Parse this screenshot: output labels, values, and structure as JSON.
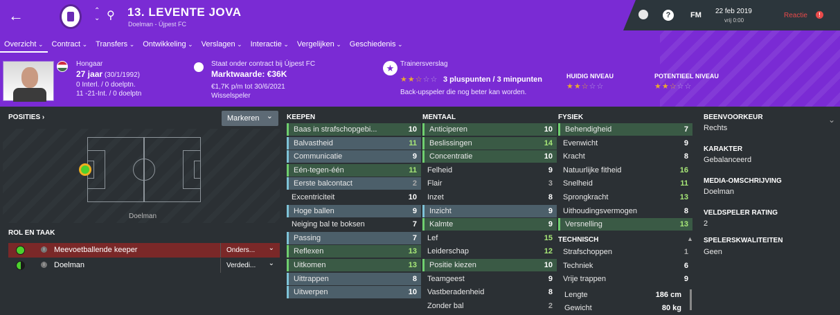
{
  "header": {
    "player_name": "13. LEVENTE JOVA",
    "subtitle": "Doelman - Újpest FC",
    "date": "22 feb 2019",
    "time": "vrij 0:00",
    "fm_label": "FM",
    "reactie": "Reactie"
  },
  "tabs": [
    "Overzicht",
    "Contract",
    "Transfers",
    "Ontwikkeling",
    "Verslagen",
    "Interactie",
    "Vergelijken",
    "Geschiedenis"
  ],
  "bio": {
    "nationality": "Hongaar",
    "age": "27 jaar",
    "dob": "(30/1/1992)",
    "caps": "0 Interl. / 0 doelptn.",
    "u21": "11 -21-Int. / 0 doelptn"
  },
  "contract": {
    "status": "Staat onder contract bij Újpest FC",
    "value": "Marktwaarde: €36K",
    "wage": "€1,7K p/m tot 30/6/2021",
    "role": "Wisselspeler"
  },
  "coach": {
    "title": "Trainersverslag",
    "points": "3 pluspunten / 3 minpunten",
    "desc": "Back-upspeler die nog beter kan worden.",
    "stars": "★★☆",
    "stars_off": "☆☆"
  },
  "levels": {
    "current_label": "HUIDIG NIVEAU",
    "potential_label": "POTENTIEEL NIVEAU",
    "current": "★★☆",
    "current_off": "☆☆",
    "potential": "★★☆",
    "potential_off": "☆☆"
  },
  "positions": {
    "title": "POSITIES ›",
    "marker": "Markeren",
    "position_label": "Doelman"
  },
  "roles": {
    "title": "ROL EN TAAK",
    "rows": [
      {
        "name": "Meevoetballende keeper",
        "duty": "Onders..."
      },
      {
        "name": "Doelman",
        "duty": "Verdedi..."
      }
    ]
  },
  "keepen": {
    "title": "KEEPEN",
    "items": [
      {
        "n": "Baas in strafschopgebi...",
        "v": "10"
      },
      {
        "n": "Balvastheid",
        "v": "11"
      },
      {
        "n": "Communicatie",
        "v": "9"
      },
      {
        "n": "Eén-tegen-één",
        "v": "11"
      },
      {
        "n": "Eerste balcontact",
        "v": "2"
      },
      {
        "n": "Excentriciteit",
        "v": "10"
      },
      {
        "n": "Hoge ballen",
        "v": "9"
      },
      {
        "n": "Neiging bal te boksen",
        "v": "7"
      },
      {
        "n": "Passing",
        "v": "7"
      },
      {
        "n": "Reflexen",
        "v": "13"
      },
      {
        "n": "Uitkomen",
        "v": "13"
      },
      {
        "n": "Uittrappen",
        "v": "8"
      },
      {
        "n": "Uitwerpen",
        "v": "10"
      }
    ]
  },
  "mentaal": {
    "title": "MENTAAL",
    "items": [
      {
        "n": "Anticiperen",
        "v": "10"
      },
      {
        "n": "Beslissingen",
        "v": "14"
      },
      {
        "n": "Concentratie",
        "v": "10"
      },
      {
        "n": "Felheid",
        "v": "9"
      },
      {
        "n": "Flair",
        "v": "3"
      },
      {
        "n": "Inzet",
        "v": "8"
      },
      {
        "n": "Inzicht",
        "v": "9"
      },
      {
        "n": "Kalmte",
        "v": "9"
      },
      {
        "n": "Lef",
        "v": "15"
      },
      {
        "n": "Leiderschap",
        "v": "12"
      },
      {
        "n": "Positie kiezen",
        "v": "10"
      },
      {
        "n": "Teamgeest",
        "v": "9"
      },
      {
        "n": "Vastberadenheid",
        "v": "8"
      },
      {
        "n": "Zonder bal",
        "v": "2"
      }
    ]
  },
  "fysiek": {
    "title": "FYSIEK",
    "items": [
      {
        "n": "Behendigheid",
        "v": "7"
      },
      {
        "n": "Evenwicht",
        "v": "9"
      },
      {
        "n": "Kracht",
        "v": "8"
      },
      {
        "n": "Natuurlijke fitheid",
        "v": "16"
      },
      {
        "n": "Snelheid",
        "v": "11"
      },
      {
        "n": "Sprongkracht",
        "v": "13"
      },
      {
        "n": "Uithoudingsvermogen",
        "v": "8"
      },
      {
        "n": "Versnelling",
        "v": "13"
      }
    ]
  },
  "technisch": {
    "title": "TECHNISCH",
    "items": [
      {
        "n": "Strafschoppen",
        "v": "1"
      },
      {
        "n": "Techniek",
        "v": "6"
      },
      {
        "n": "Vrije trappen",
        "v": "9"
      }
    ]
  },
  "body": {
    "lengte_label": "Lengte",
    "lengte": "186 cm",
    "gewicht_label": "Gewicht",
    "gewicht": "80 kg"
  },
  "side": {
    "foot_label": "BEENVOORKEUR",
    "foot": "Rechts",
    "karakter_label": "KARAKTER",
    "karakter": "Gebalanceerd",
    "media_label": "MEDIA-OMSCHRIJVING",
    "media": "Doelman",
    "rating_label": "VELDSPELER RATING",
    "rating": "2",
    "qual_label": "SPELERSKWALITEITEN",
    "qual": "Geen"
  }
}
